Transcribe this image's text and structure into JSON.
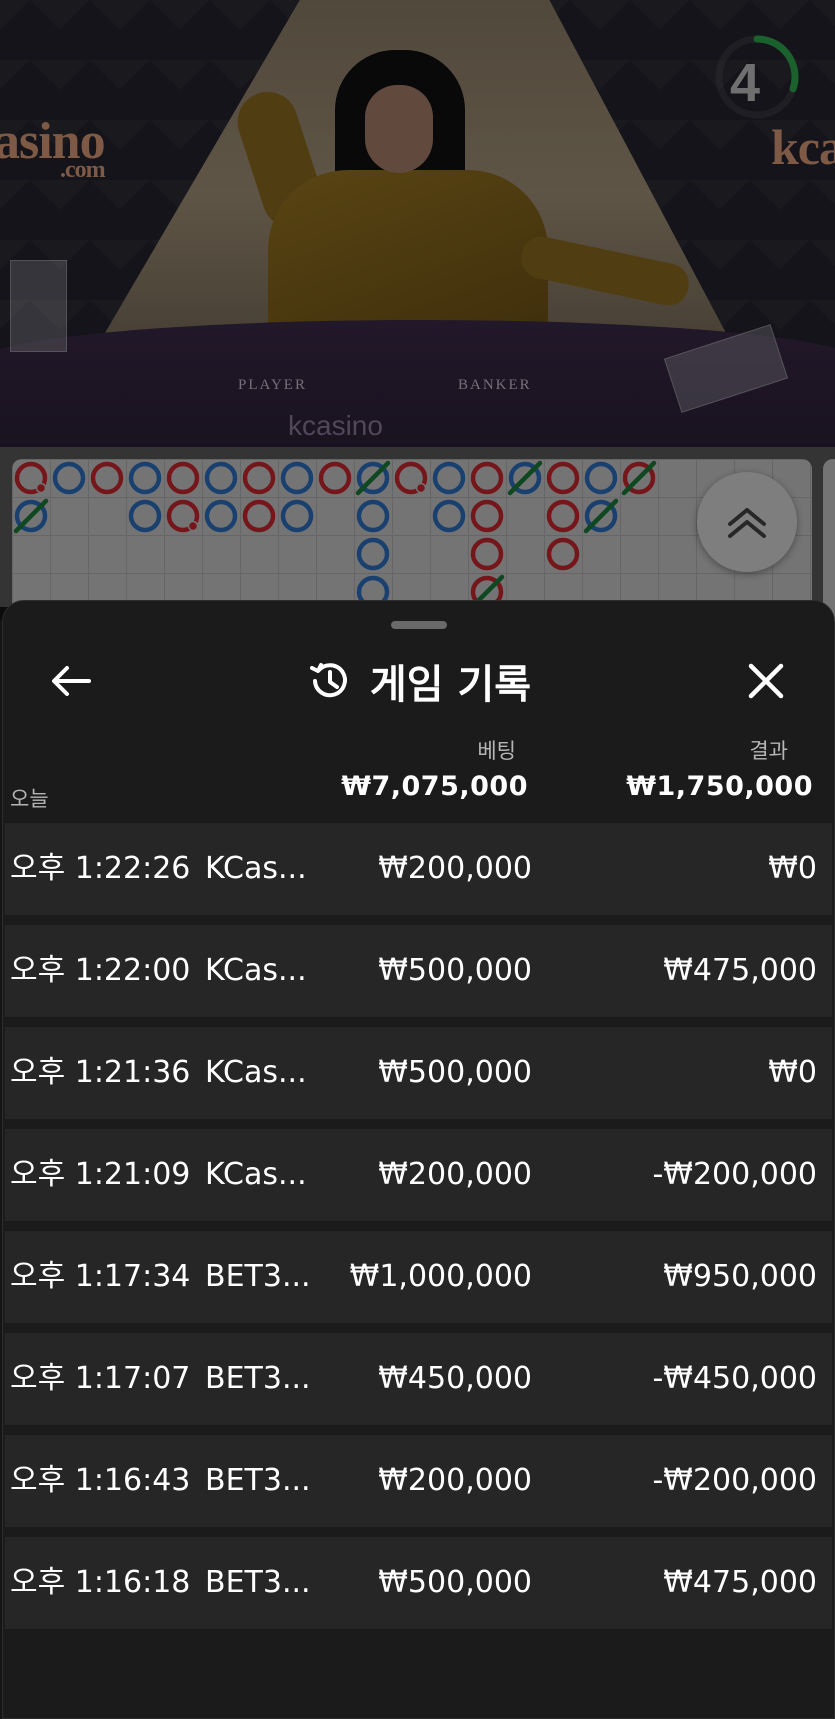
{
  "video": {
    "brand_left": "asino",
    "brand_left_sub": ".com",
    "brand_right": "kca",
    "table_player": "PLAYER",
    "table_banker": "BANKER",
    "table_logo": "kcasino",
    "countdown": "4",
    "countdown_fraction": 0.3
  },
  "roadmap": {
    "colors": {
      "banker": "#c9262e",
      "player": "#2c6fc0",
      "tie": "#1a7a3a"
    },
    "columns": [
      [
        "banker-pair",
        "player-tie"
      ],
      [
        "player"
      ],
      [
        "banker"
      ],
      [
        "player",
        "player"
      ],
      [
        "banker",
        "banker-pair"
      ],
      [
        "player",
        "player"
      ],
      [
        "banker",
        "banker"
      ],
      [
        "player",
        "player"
      ],
      [
        "banker"
      ],
      [
        "player-tie",
        "player",
        "player",
        "player"
      ],
      [
        "banker-pair"
      ],
      [
        "player",
        "player"
      ],
      [
        "banker",
        "banker",
        "banker",
        "banker-tie"
      ],
      [
        "player-tie"
      ],
      [
        "banker",
        "banker",
        "banker"
      ],
      [
        "player",
        "player-tie"
      ],
      [
        "banker-tie"
      ]
    ]
  },
  "sheet": {
    "title": "게임 기록",
    "col_bet": "베팅",
    "col_result": "결과",
    "today": "오늘",
    "total_bet": "₩7,075,000",
    "total_result": "₩1,750,000",
    "rows": [
      {
        "time": "오후 1:22:26",
        "game": "KCas...",
        "bet": "₩200,000",
        "result": "₩0"
      },
      {
        "time": "오후 1:22:00",
        "game": "KCas...",
        "bet": "₩500,000",
        "result": "₩475,000"
      },
      {
        "time": "오후 1:21:36",
        "game": "KCas...",
        "bet": "₩500,000",
        "result": "₩0"
      },
      {
        "time": "오후 1:21:09",
        "game": "KCas...",
        "bet": "₩200,000",
        "result": "-₩200,000"
      },
      {
        "time": "오후 1:17:34",
        "game": "BET3...",
        "bet": "₩1,000,000",
        "result": "₩950,000"
      },
      {
        "time": "오후 1:17:07",
        "game": "BET3...",
        "bet": "₩450,000",
        "result": "-₩450,000"
      },
      {
        "time": "오후 1:16:43",
        "game": "BET3...",
        "bet": "₩200,000",
        "result": "-₩200,000"
      },
      {
        "time": "오후 1:16:18",
        "game": "BET3...",
        "bet": "₩500,000",
        "result": "₩475,000"
      }
    ]
  }
}
